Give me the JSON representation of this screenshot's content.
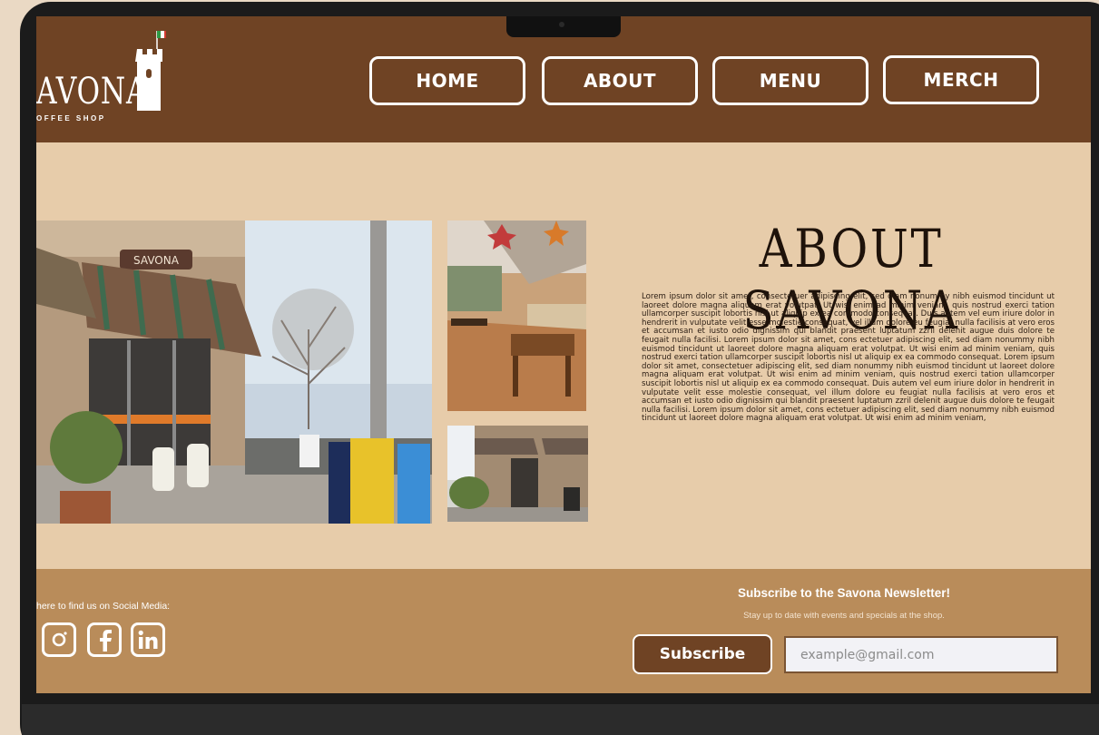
{
  "brand": {
    "name": "AVONA",
    "tagline": "OFFEE SHOP"
  },
  "nav": {
    "items": [
      "HOME",
      "ABOUT",
      "MENU",
      "MERCH"
    ]
  },
  "storefront_sign": "SAVONA",
  "about": {
    "title": "ABOUT SAVONA",
    "body": "Lorem ipsum dolor sit amet, consectetuer adipiscing elit, sed diam nonummy nibh euismod tincidunt ut laoreet dolore magna aliquam erat volutpat. Ut wisi enim ad minim veniam, quis nostrud exerci tation ullamcorper suscipit lobortis nisl ut aliquip ex ea commodo consequat. Duis autem vel eum iriure dolor in hendrerit in vulputate velit esse molestie consequat, vel illum dolore eu feugiat nulla facilisis at vero eros et accumsan et iusto odio dignissim qui blandit praesent luptatum zzril delenit augue duis dolore te feugait nulla facilisi. Lorem ipsum dolor sit amet, cons ectetuer adipiscing elit, sed diam nonummy nibh euismod tincidunt ut laoreet dolore magna aliquam erat volutpat. Ut wisi enim ad minim veniam, quis nostrud exerci tation ullamcorper suscipit lobortis nisl ut aliquip ex ea commodo consequat. Lorem ipsum dolor sit amet, consectetuer adipiscing elit, sed diam nonummy nibh euismod tincidunt ut laoreet dolore magna aliquam erat volutpat. Ut wisi enim ad minim veniam, quis nostrud exerci tation ullamcorper suscipit lobortis nisl ut aliquip ex ea commodo consequat. Duis autem vel eum iriure dolor in hendrerit in vulputate velit esse molestie consequat, vel illum dolore eu feugiat nulla facilisis at vero eros et accumsan et iusto odio dignissim qui blandit praesent luptatum zzril delenit augue duis dolore te feugait nulla facilisi. Lorem ipsum dolor sit amet, cons ectetuer adipiscing elit, sed diam nonummy nibh euismod tincidunt ut laoreet dolore magna aliquam erat volutpat. Ut wisi enim ad minim veniam,"
  },
  "footer": {
    "social_label": "here to find us on Social Media:",
    "social_icons": [
      "instagram-icon",
      "facebook-icon",
      "linkedin-icon"
    ],
    "newsletter_title": "Subscribe to the Savona Newsletter!",
    "newsletter_sub": "Stay up to date with events and specials at the shop.",
    "subscribe_label": "Subscribe",
    "email_placeholder": "example@gmail.com"
  },
  "colors": {
    "header": "#6f4324",
    "body_bg": "#e7ccaa",
    "footer": "#b98c5a",
    "page_bg": "#ead9c4"
  }
}
